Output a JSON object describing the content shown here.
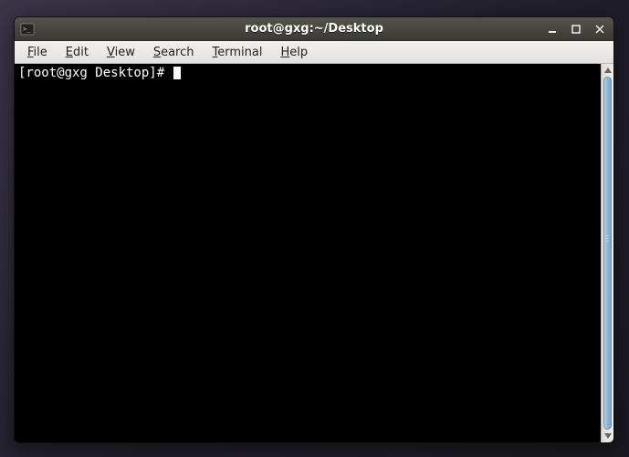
{
  "window": {
    "title": "root@gxg:~/Desktop"
  },
  "menubar": {
    "items": [
      {
        "underline": "F",
        "rest": "ile"
      },
      {
        "underline": "E",
        "rest": "dit"
      },
      {
        "underline": "V",
        "rest": "iew"
      },
      {
        "underline": "S",
        "rest": "earch"
      },
      {
        "underline": "T",
        "rest": "erminal"
      },
      {
        "underline": "H",
        "rest": "elp"
      }
    ]
  },
  "terminal": {
    "prompt": "[root@gxg Desktop]# "
  }
}
